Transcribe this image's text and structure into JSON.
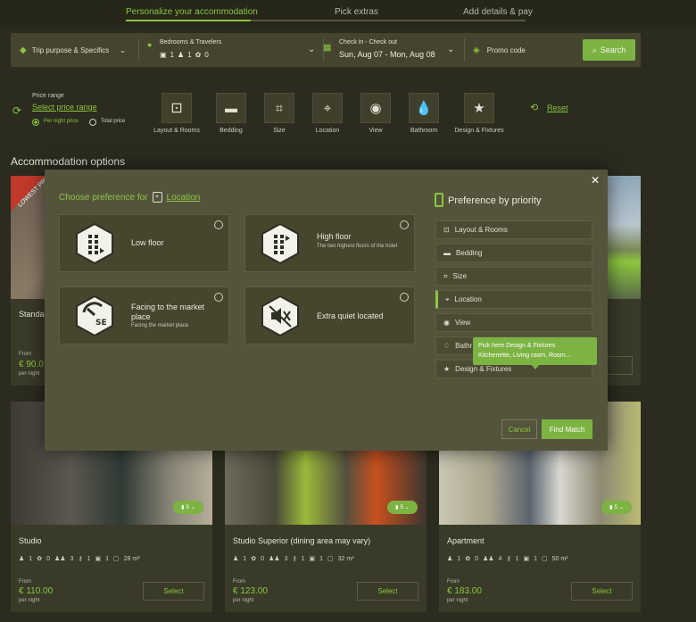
{
  "steps": [
    "Personalize your accommodation",
    "Pick extras",
    "Add details & pay"
  ],
  "search": {
    "purpose": "Trip purpose & Specifics",
    "bedrooms_label": "Bedrooms & Travelers",
    "bedrooms_count": "1",
    "travelers_count": "1",
    "pets_count": "0",
    "dates_label": "Check in - Check out",
    "dates_value": "Sun, Aug 07 - Mon, Aug 08",
    "promo": "Promo code",
    "search_button": "Search"
  },
  "price_filter": {
    "label": "Price range",
    "link": "Select price range",
    "per_night": "Per night price",
    "total": "Total price"
  },
  "filters": [
    "Layout & Rooms",
    "Bedding",
    "Size",
    "Location",
    "View",
    "Bathroom",
    "Design & Fixtures"
  ],
  "reset": "Reset",
  "section_title": "Accommodation options",
  "top_cards": [
    {
      "title": "Standa",
      "price": "€ 90.0",
      "from": "From",
      "per_night": "per night",
      "promo": "LOWEST PRICE"
    }
  ],
  "cards": [
    {
      "title": "Studio",
      "price": "€ 110.00",
      "from": "From",
      "per_night": "per night",
      "select": "Select",
      "badge": "5",
      "c1": "1",
      "c2": "0",
      "c3": "3",
      "c4": "1",
      "c5": "1",
      "size": "28 m²"
    },
    {
      "title": "Studio Superior (dining area may vary)",
      "price": "€ 123.00",
      "from": "From",
      "per_night": "per night",
      "select": "Select",
      "badge": "5",
      "c1": "1",
      "c2": "0",
      "c3": "3",
      "c4": "1",
      "c5": "1",
      "size": "32 m²"
    },
    {
      "title": "Apartment",
      "price": "€ 183.00",
      "from": "From",
      "per_night": "per night",
      "select": "Select",
      "badge": "5",
      "c1": "1",
      "c2": "0",
      "c3": "4",
      "c4": "1",
      "c5": "1",
      "size": "50 m²"
    }
  ],
  "modal": {
    "choose_label": "Choose preference for",
    "choose_target": "Location",
    "options": [
      {
        "label": "Low floor",
        "sub": ""
      },
      {
        "label": "High floor",
        "sub": "The two highest floors of the hotel"
      },
      {
        "label": "Facing to the market place",
        "sub": "Facing the market place"
      },
      {
        "label": "Extra quiet located",
        "sub": ""
      }
    ],
    "priority_title": "Preference by priority",
    "priority_items": [
      "Layout & Rooms",
      "Bedding",
      "Size",
      "Location",
      "View",
      "Bathr",
      "Design & Fixtures"
    ],
    "tooltip_title": "Pick here Design & Fixtures",
    "tooltip_sub": "Kitchenette, Living room, Room...",
    "cancel": "Cancel",
    "find": "Find Match",
    "close": "✕"
  },
  "colors": {
    "accent": "#8cc63f",
    "bg": "#2b2b1f",
    "modal": "#54543d"
  }
}
